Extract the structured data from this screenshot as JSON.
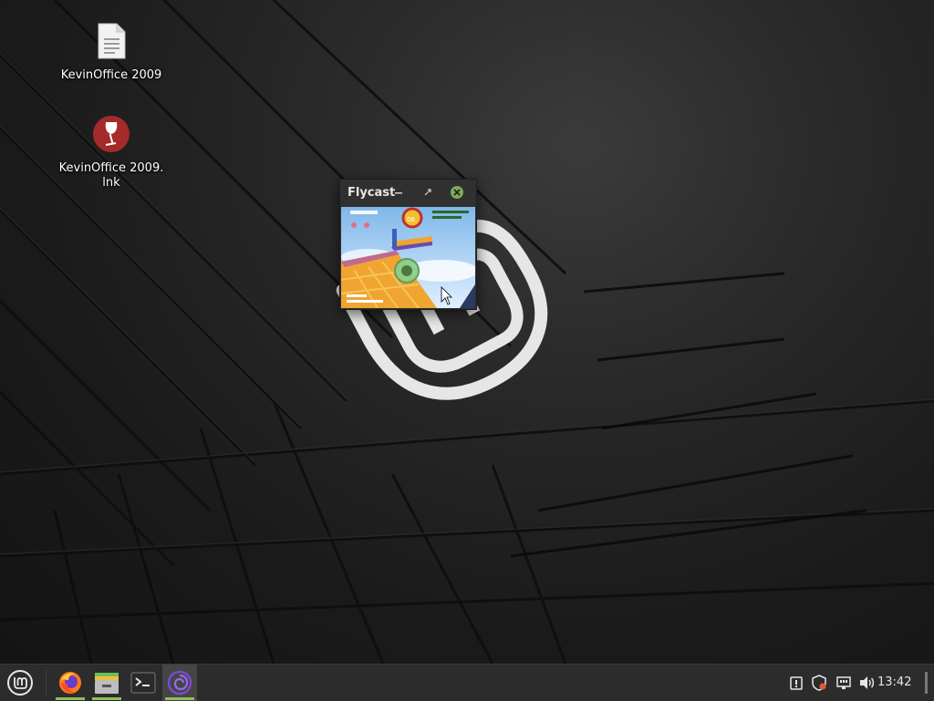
{
  "desktop": {
    "icons": [
      {
        "label": "KevinOffice 2009",
        "icon": "document-icon"
      },
      {
        "label": "KevinOffice 2009.\nlnk",
        "icon": "wine-icon"
      }
    ]
  },
  "window": {
    "title": "Flycast",
    "content": "game-screen",
    "buttons": [
      "minimize",
      "maximize",
      "close"
    ]
  },
  "taskbar": {
    "menu": "linux-mint-menu-icon",
    "apps": [
      {
        "name": "firefox-icon",
        "running": true
      },
      {
        "name": "file-manager-icon",
        "running": true
      },
      {
        "name": "terminal-icon",
        "running": false
      },
      {
        "name": "flycast-icon",
        "running": true,
        "active": true
      }
    ],
    "tray": [
      "update-manager-icon",
      "shield-icon",
      "network-icon",
      "volume-icon"
    ],
    "clock": "13:42"
  },
  "colors": {
    "accent": "#8fbf5a",
    "panel": "#2c2c2c",
    "close": "#7fa859"
  }
}
